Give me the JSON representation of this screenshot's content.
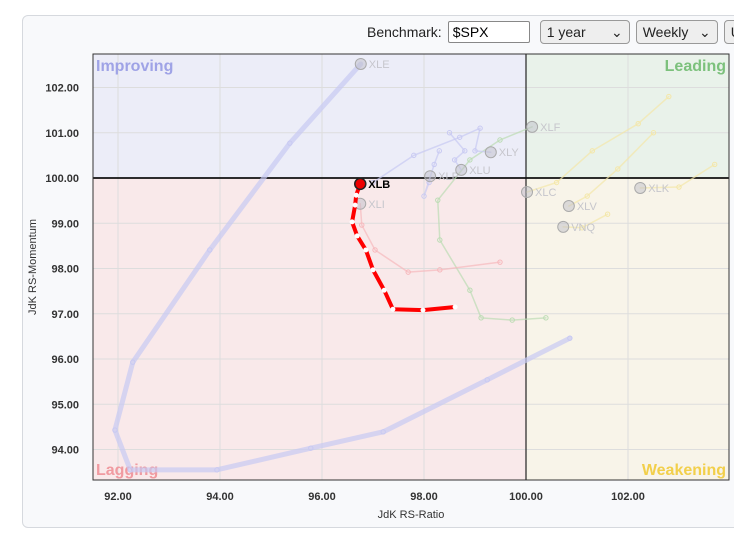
{
  "toolbar": {
    "benchmark_label": "Benchmark:",
    "benchmark_value": "$SPX",
    "period": "1 year",
    "interval": "Weekly",
    "extra": "U"
  },
  "chart_data": {
    "type": "scatter",
    "xlabel": "JdK RS-Ratio",
    "ylabel": "JdK RS-Momentum",
    "xlim": [
      91.5,
      104
    ],
    "ylim": [
      93.3,
      102.7
    ],
    "xticks": [
      92,
      94,
      96,
      98,
      100,
      102
    ],
    "yticks": [
      94,
      95,
      96,
      97,
      98,
      99,
      100,
      101,
      102
    ],
    "xtick_labels": [
      "92.00",
      "94.00",
      "96.00",
      "98.00",
      "100.00",
      "102.00"
    ],
    "ytick_labels": [
      "94.00",
      "95.00",
      "96.00",
      "97.00",
      "98.00",
      "99.00",
      "100.00",
      "101.00",
      "102.00"
    ],
    "quadrants": {
      "improving": "Improving",
      "leading": "Leading",
      "lagging": "Lagging",
      "weakening": "Weakening"
    },
    "colors": {
      "improving": "#ecedf8",
      "leading": "#e9f2ea",
      "lagging": "#f9e9ea",
      "weakening": "#f8f4e9",
      "improving_text": "#9fa3e6",
      "leading_text": "#7cc17c",
      "lagging_text": "#f09aa0",
      "weakening_text": "#f2cf4a"
    },
    "series": [
      {
        "name": "XLE",
        "color": "#c8c9f2",
        "highlight": false,
        "points": [
          [
            100.86,
            96.46
          ],
          [
            99.24,
            95.54
          ],
          [
            97.2,
            94.39
          ],
          [
            95.78,
            94.03
          ],
          [
            93.94,
            93.55
          ],
          [
            92.24,
            93.55
          ],
          [
            91.94,
            94.43
          ],
          [
            92.29,
            95.93
          ],
          [
            93.8,
            98.41
          ],
          [
            95.37,
            100.77
          ],
          [
            96.76,
            102.52
          ]
        ]
      },
      {
        "name": "XLF",
        "color": "#bcdcb4",
        "highlight": false,
        "points": [
          [
            100.39,
            96.91
          ],
          [
            99.73,
            96.86
          ],
          [
            99.12,
            96.91
          ],
          [
            98.9,
            97.52
          ],
          [
            98.31,
            98.63
          ],
          [
            98.27,
            99.51
          ],
          [
            98.9,
            100.4
          ],
          [
            99.49,
            100.84
          ],
          [
            100.12,
            101.13
          ]
        ]
      },
      {
        "name": "XLI",
        "color": "#f7b8bc",
        "highlight": false,
        "points": [
          [
            99.49,
            98.14
          ],
          [
            98.31,
            97.97
          ],
          [
            97.69,
            97.92
          ],
          [
            97.04,
            98.41
          ],
          [
            96.78,
            98.96
          ],
          [
            96.75,
            99.43
          ]
        ]
      },
      {
        "name": "XLY",
        "color": "#c8c9f2",
        "highlight": false,
        "points": [
          [
            97.0,
            99.9
          ],
          [
            97.8,
            100.5
          ],
          [
            98.7,
            100.9
          ],
          [
            99.1,
            101.1
          ],
          [
            99.0,
            100.6
          ],
          [
            99.31,
            100.57
          ]
        ]
      },
      {
        "name": "XLP",
        "color": "#c8c9f2",
        "highlight": false,
        "points": [
          [
            98.3,
            100.6
          ],
          [
            98.2,
            100.3
          ],
          [
            98.0,
            99.6
          ],
          [
            98.1,
            99.9
          ],
          [
            98.12,
            100.04
          ]
        ]
      },
      {
        "name": "XLU",
        "color": "#c8c9f2",
        "highlight": false,
        "points": [
          [
            98.5,
            101.0
          ],
          [
            98.8,
            100.6
          ],
          [
            98.6,
            100.4
          ],
          [
            98.73,
            100.18
          ]
        ]
      },
      {
        "name": "XLC",
        "color": "#f4e7a8",
        "highlight": false,
        "points": [
          [
            102.8,
            101.8
          ],
          [
            102.2,
            101.2
          ],
          [
            101.3,
            100.6
          ],
          [
            100.6,
            99.9
          ],
          [
            100.02,
            99.69
          ]
        ]
      },
      {
        "name": "XLV",
        "color": "#f4e7a8",
        "highlight": false,
        "points": [
          [
            102.5,
            101.0
          ],
          [
            101.8,
            100.2
          ],
          [
            101.2,
            99.6
          ],
          [
            100.84,
            99.38
          ]
        ]
      },
      {
        "name": "XLK",
        "color": "#f4e7a8",
        "highlight": false,
        "points": [
          [
            103.7,
            100.3
          ],
          [
            103.0,
            99.8
          ],
          [
            102.24,
            99.78
          ]
        ]
      },
      {
        "name": "VNQ",
        "color": "#f4e7a8",
        "highlight": false,
        "points": [
          [
            101.6,
            99.2
          ],
          [
            101.1,
            98.9
          ],
          [
            100.73,
            98.92
          ]
        ]
      },
      {
        "name": "XLB",
        "color": "#ff0000",
        "highlight": true,
        "points": [
          [
            98.61,
            97.15
          ],
          [
            97.98,
            97.08
          ],
          [
            97.39,
            97.1
          ],
          [
            97.22,
            97.52
          ],
          [
            97.0,
            97.97
          ],
          [
            96.86,
            98.41
          ],
          [
            96.69,
            98.72
          ],
          [
            96.59,
            99.03
          ],
          [
            96.65,
            99.4
          ],
          [
            96.67,
            99.62
          ],
          [
            96.75,
            99.87
          ]
        ]
      }
    ]
  }
}
